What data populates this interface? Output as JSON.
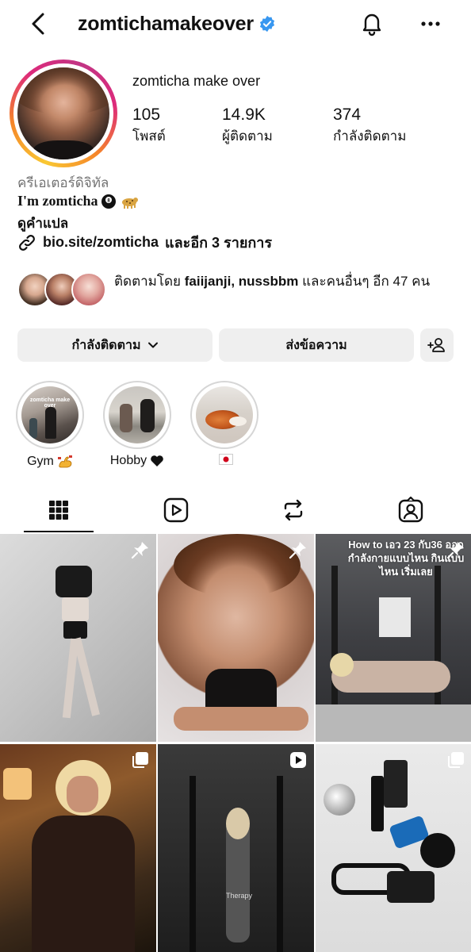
{
  "header": {
    "username": "zomtichamakeover",
    "back_icon": "chevron-left-icon",
    "verified_icon": "verified-badge-icon",
    "bell_icon": "bell-icon",
    "more_icon": "more-horizontal-icon"
  },
  "profile": {
    "display_name": "zomticha make over",
    "stats": [
      {
        "value": "105",
        "label": "โพสต์"
      },
      {
        "value": "14.9K",
        "label": "ผู้ติดตาม"
      },
      {
        "value": "374",
        "label": "กำลังติดตาม"
      }
    ],
    "category": "ครีเอเตอร์ดิจิทัล",
    "bio_name": "I'm zomticha",
    "bio_emojis": [
      "eight-ball-icon",
      "leopard-icon"
    ],
    "translate": "ดูคำแปล",
    "link": "bio.site/zomticha",
    "link_more": "และอีก 3 รายการ"
  },
  "followed_by": {
    "prefix": "ติดตามโดย",
    "names": "faiijanji, nussbbm",
    "suffix": "และคนอื่นๆ อีก 47 คน"
  },
  "actions": {
    "following_label": "กำลังติดตาม",
    "message_label": "ส่งข้อความ",
    "add_person_icon": "add-person-icon"
  },
  "highlights": [
    {
      "label": "Gym",
      "emoji": "flexed-biceps-icon",
      "cover_text": "zomticha make over"
    },
    {
      "label": "Hobby",
      "emoji": "black-heart-icon"
    },
    {
      "label": "",
      "emoji": "japan-flag-icon"
    }
  ],
  "tabs": [
    "grid-icon",
    "reels-icon",
    "repost-icon",
    "tagged-icon"
  ],
  "posts": [
    {
      "kind": "photo",
      "pinned": true
    },
    {
      "kind": "photo",
      "pinned": true
    },
    {
      "kind": "photo",
      "pinned": true,
      "overlay": "How to เอว 23 กับ36 ออกกำลังกายแบบไหน กินแบบไหน เริ่มเลย"
    },
    {
      "kind": "carousel"
    },
    {
      "kind": "reel",
      "overlay": "Therapy"
    },
    {
      "kind": "carousel"
    }
  ],
  "colors": {
    "text": "#111111",
    "muted": "#737373",
    "link": "#00376b",
    "button_bg": "#efefef",
    "verified_blue": "#3897f0"
  }
}
